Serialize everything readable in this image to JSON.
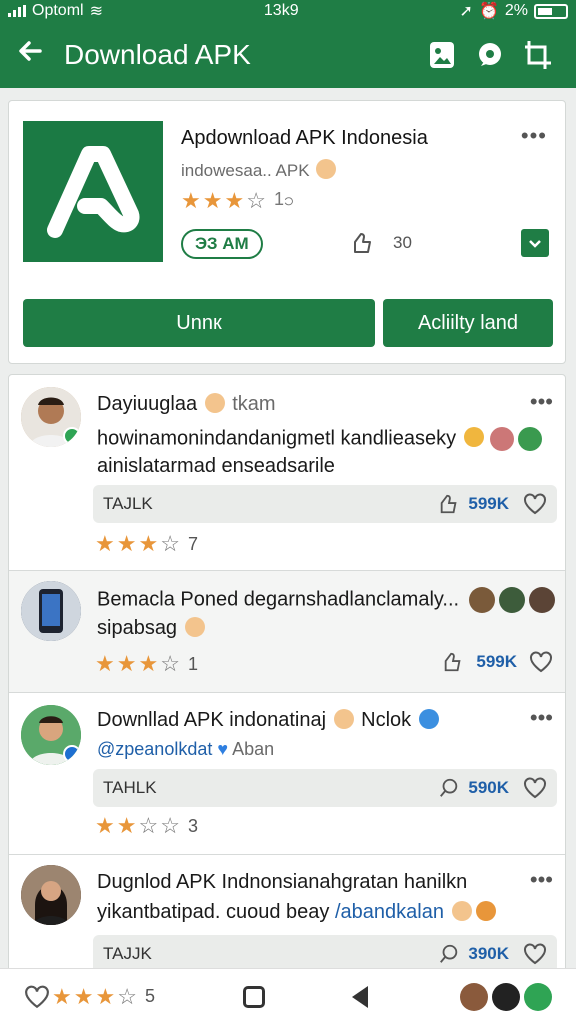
{
  "status_bar": {
    "carrier": "Optoml",
    "time": "13k9",
    "battery": "2%"
  },
  "app_bar": {
    "title": "Download APK"
  },
  "app_card": {
    "name": "Apdownload APK Indonesia",
    "developer": "indowesaa.. APK",
    "rating_count": "1၁",
    "chip_label": "ЭЗ АМ",
    "likes": "30",
    "primary_button": "Unnк",
    "secondary_button": "Acliilty land"
  },
  "posts": [
    {
      "author": "Dayiuuglaa",
      "author_suffix": "tkam",
      "line1": "howinamonindandanigmetl kandlieaseky",
      "line2": "ainislatarmad enseadsarile",
      "tag": "TAJLK",
      "count": "599K",
      "stars": 3,
      "star_label": "7"
    },
    {
      "author": "Bemacla Poned degarnshadlanclamaly...",
      "line1": "sipabsag",
      "count": "599K",
      "stars": 3,
      "star_label": "1"
    },
    {
      "author": "Downllad APK indonatinaj",
      "author_suffix": "Nclok",
      "line1": "@zpeanolkdat",
      "line1_suffix": "Aban",
      "tag": "TAHLK",
      "count": "590K",
      "stars": 2,
      "star_label": "3"
    },
    {
      "author": "Duɡnlod APK Indnonsianahgratan hanilkn",
      "line1": "yikantbatipad. cuoud beay",
      "line1_link": "/abandkalan",
      "tag": "TAJJK",
      "count": "390K",
      "stars": 3,
      "star_label": "5"
    }
  ],
  "colors": {
    "primary": "#1f7d45",
    "accent_star": "#e8963a",
    "count_blue": "#1f5fa8"
  },
  "icons": [
    "back-arrow-icon",
    "image-icon",
    "chat-icon",
    "crop-icon",
    "more-icon",
    "like-icon",
    "heart-icon",
    "star-icon",
    "home-icon",
    "nav-back-icon"
  ]
}
